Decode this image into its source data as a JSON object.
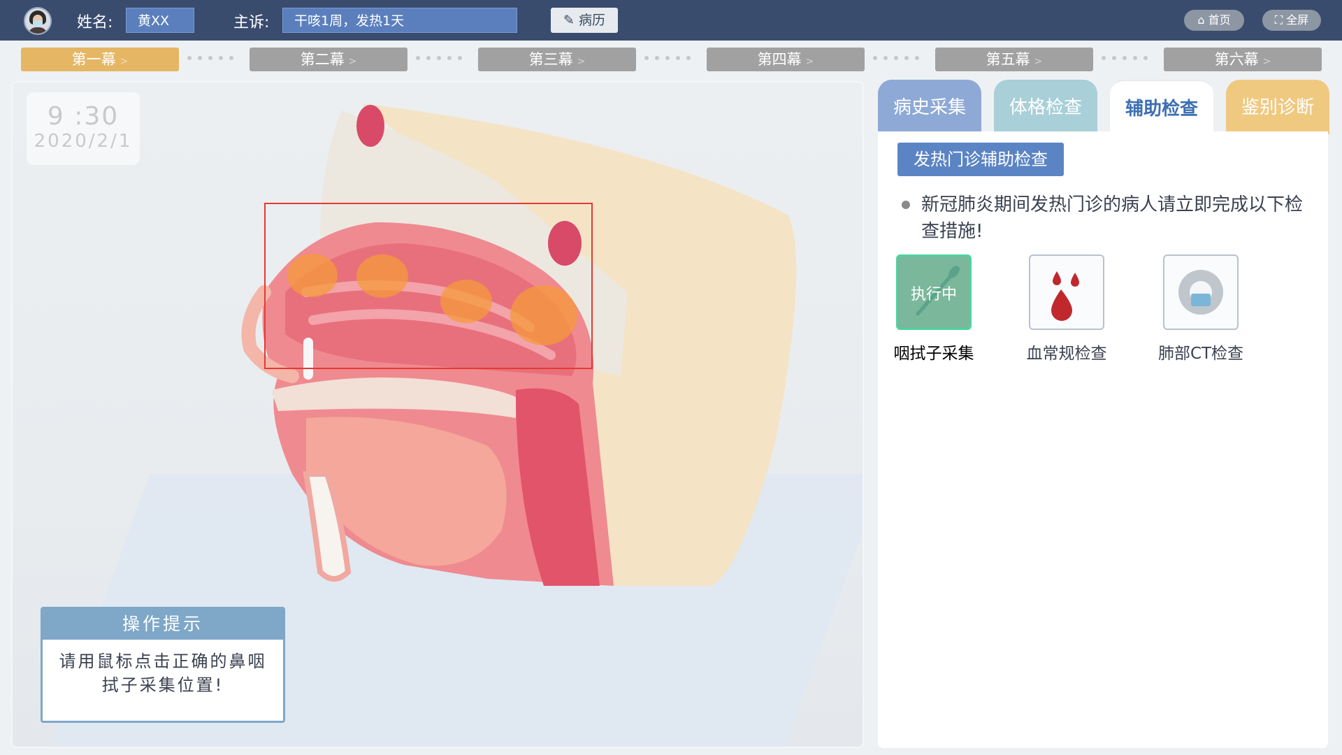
{
  "header": {
    "name_label": "姓名:",
    "name_value": "黄XX",
    "complaint_label": "主诉:",
    "complaint_value": "干咳1周，发热1天",
    "record_button": "病历",
    "home_button": "首页",
    "fullscreen_button": "全屏"
  },
  "acts": [
    {
      "label": "第一幕",
      "active": true
    },
    {
      "label": "第二幕",
      "active": false
    },
    {
      "label": "第三幕",
      "active": false
    },
    {
      "label": "第四幕",
      "active": false
    },
    {
      "label": "第五幕",
      "active": false
    },
    {
      "label": "第六幕",
      "active": false
    }
  ],
  "scene": {
    "clock_time": "9 :30",
    "clock_date": "2020/2/1",
    "tip_title": "操作提示",
    "tip_body": "请用鼠标点击正确的鼻咽拭子采集位置!"
  },
  "tabs": [
    {
      "label": "病史采集",
      "color": "#8ea9d6"
    },
    {
      "label": "体格检查",
      "color": "#a9cfd8"
    },
    {
      "label": "辅助检查",
      "color": "#ffffff",
      "active": true
    },
    {
      "label": "鉴别诊断",
      "color": "#f0c980"
    }
  ],
  "panel": {
    "section_title": "发热门诊辅助检查",
    "notice": "新冠肺炎期间发热门诊的病人请立即完成以下检查措施!",
    "exams": [
      {
        "label": "咽拭子采集",
        "status": "执行中",
        "icon": "swab-icon",
        "active": true
      },
      {
        "label": "血常规检查",
        "icon": "blood-drop-icon",
        "active": false
      },
      {
        "label": "肺部CT检查",
        "icon": "ct-scanner-icon",
        "active": false
      }
    ]
  },
  "colors": {
    "topbar": "#3a4c6e",
    "active_act": "#e5b664",
    "inactive_act": "#a1a1a1",
    "target_frame": "#e53935",
    "hotspot": "#f59a3a"
  }
}
